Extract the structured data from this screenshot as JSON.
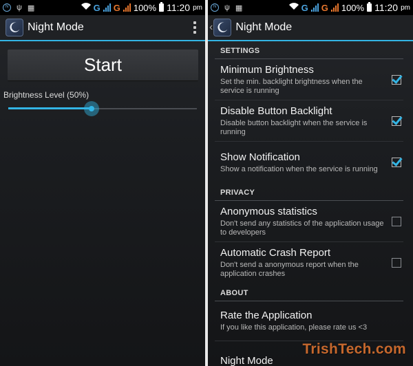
{
  "status_bar": {
    "network_g1": "G",
    "network_g2": "G",
    "battery_percent": "100%",
    "time": "11:20",
    "ampm": "pm"
  },
  "left": {
    "app_title": "Night Mode",
    "start_label": "Start",
    "brightness_label": "Brightness Level  (50%)",
    "brightness_level": 0.44
  },
  "right": {
    "app_title": "Night Mode",
    "categories": {
      "settings": "SETTINGS",
      "privacy": "PRIVACY",
      "about": "ABOUT"
    },
    "prefs": {
      "min_brightness": {
        "title": "Minimum Brightness",
        "summary": "Set the min. backlight brightness when the service is running",
        "checked": true
      },
      "disable_backlight": {
        "title": "Disable Button Backlight",
        "summary": "Disable button backlight when the service is running",
        "checked": true
      },
      "show_notification": {
        "title": "Show Notification",
        "summary": "Show a notification when the service is running",
        "checked": true
      },
      "anon_stats": {
        "title": "Anonymous statistics",
        "summary": "Don't send any statistics of the application usage to developers",
        "checked": false
      },
      "crash_report": {
        "title": "Automatic Crash Report",
        "summary": "Don't send a anonymous report when the application crashes",
        "checked": false
      },
      "rate_app": {
        "title": "Rate the Application",
        "summary": "If you like this application, please rate us <3"
      },
      "night_mode": {
        "title": "Night Mode"
      }
    }
  },
  "watermark": "TrishTech.com",
  "colors": {
    "accent": "#33b5e5",
    "watermark": "#e67832"
  }
}
